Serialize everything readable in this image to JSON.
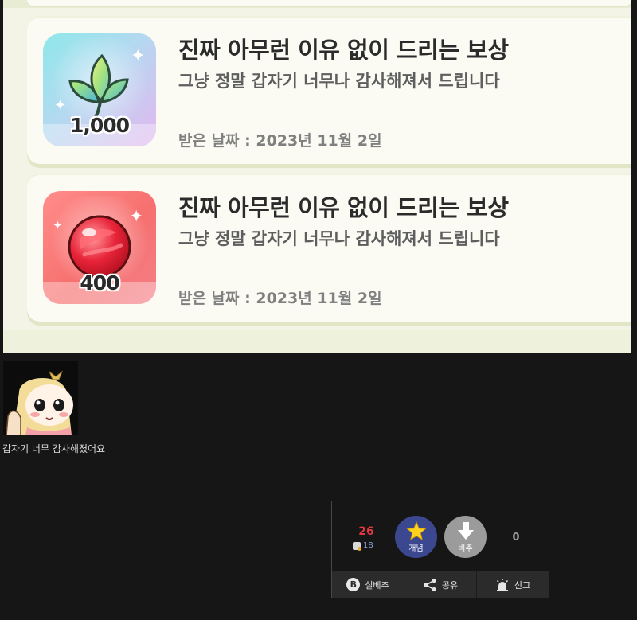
{
  "rewards": [
    {
      "quantity": "1,000",
      "item_icon": "rainbow-leaf-icon",
      "title": "진짜 아무런 이유 없이 드리는 보상",
      "description": "그냥 정말 갑자기 너무나 감사해져서 드립니다",
      "date": "받은 날짜 : 2023년 11월 2일"
    },
    {
      "quantity": "400",
      "item_icon": "red-jelly-ball-icon",
      "title": "진짜 아무런 이유 없이 드리는 보상",
      "description": "그냥 정말 갑자기 너무나 감사해져서 드립니다",
      "date": "받은 날짜 : 2023년 11월 2일"
    }
  ],
  "post": {
    "caption": "갑자기 너무 감사해졌어요"
  },
  "vote": {
    "up_count": "26",
    "fixed_count": "18",
    "up_label": "개념",
    "down_label": "비추",
    "down_count": "0",
    "actions": {
      "real_down_badge": "B",
      "real_down": "실베추",
      "share": "공유",
      "report": "신고"
    }
  },
  "colors": {
    "background": "#161616",
    "up_count": "#e0393e",
    "up_button": "#3b4890",
    "down_button": "#9b9b9b"
  }
}
